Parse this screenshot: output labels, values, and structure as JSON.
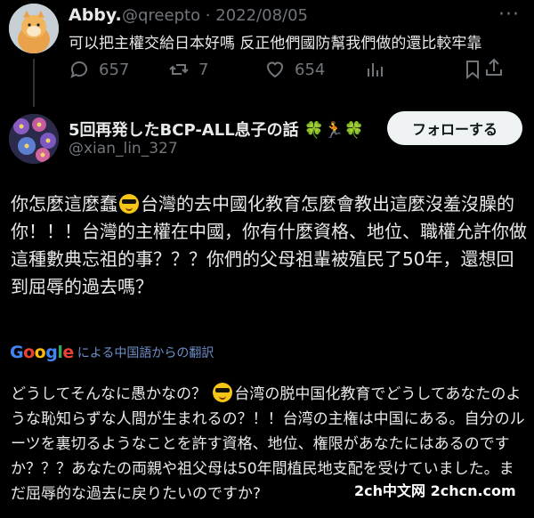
{
  "reply_tweet": {
    "display_name": "Abby.",
    "handle_date": "@qreepto · 2022/08/05",
    "more_label": "···",
    "text": "可以把主權交給日本好嗎 反正他們國防幫我們做的還比較牢靠",
    "actions": {
      "replies": "657",
      "retweets": "7",
      "likes": "654"
    }
  },
  "main_tweet": {
    "display_name": "5回再発したBCP-ALL息子の話 🍀🏃🍀",
    "handle": "@xian_lin_327",
    "follow_label": "フォローする",
    "text_before_emoji": "你怎麼這麼蠢",
    "text_after_emoji": "台灣的去中國化教育怎麼會教出這麼沒羞沒臊的你！！！台灣的主權在中國，你有什麼資格、地位、職權允許你做這種數典忘祖的事？？？你們的父母祖輩被殖民了50年，還想回到屈辱的過去嗎？",
    "translation_caption": "による中国語からの翻訳",
    "translation_before_emoji": "どうしてそんなに愚かなの？",
    "translation_after_emoji": "台湾の脱中国化教育でどうしてあなたのような恥知らずな人間が生まれるの？！！台湾の主権は中国にある。自分のルーツを裏切るようなことを許す資格、地位、権限があなたにはあるのですか？？？あなたの両親や祖父母は50年間植民地支配を受けていました。まだ屈辱的な過去に戻りたいのですか?"
  },
  "google_logo": {
    "letters": [
      "G",
      "o",
      "o",
      "g",
      "l",
      "e"
    ],
    "colors": [
      "#4285f4",
      "#ea4335",
      "#fbbc05",
      "#4285f4",
      "#34a853",
      "#ea4335"
    ]
  },
  "icons": {
    "reply": "reply-icon",
    "retweet": "retweet-icon",
    "like": "heart-icon",
    "views": "analytics-icon",
    "bookmark": "bookmark-icon",
    "share": "share-icon"
  },
  "watermark": "2ch中文网 2chcn.com",
  "colors": {
    "background": "#000000",
    "text": "#e7e9ea",
    "muted": "#71767b",
    "follow_bg": "#eff3f4",
    "link": "#6e8fc9"
  }
}
